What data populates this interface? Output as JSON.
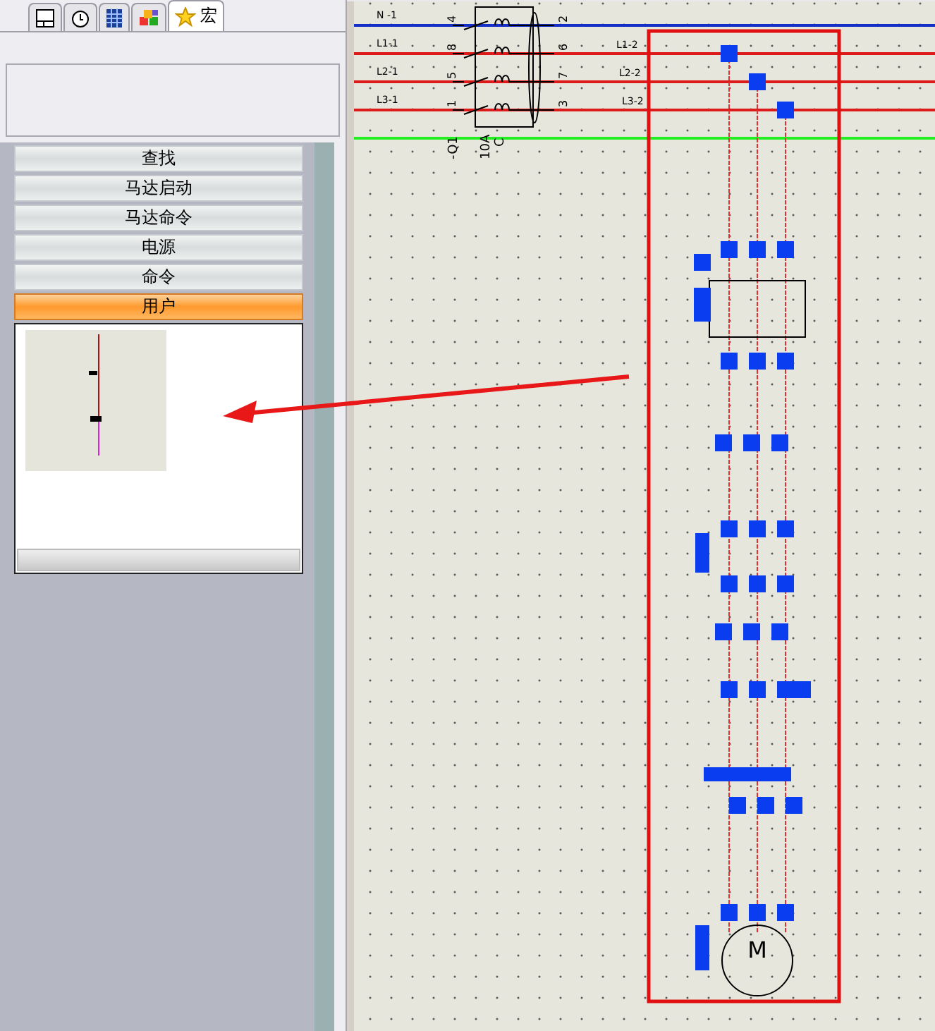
{
  "sidebar": {
    "tabs": [
      {
        "kind": "layout",
        "selected": false
      },
      {
        "kind": "clock",
        "selected": false
      },
      {
        "kind": "grid",
        "selected": false
      },
      {
        "kind": "cubes",
        "selected": false
      },
      {
        "kind": "star",
        "label": "宏",
        "selected": true
      }
    ],
    "groups": [
      {
        "label": "查找",
        "selected": false
      },
      {
        "label": "马达启动",
        "selected": false
      },
      {
        "label": "马达命令",
        "selected": false
      },
      {
        "label": "电源",
        "selected": false
      },
      {
        "label": "命令",
        "selected": false
      },
      {
        "label": "用户",
        "selected": true
      }
    ]
  },
  "schematic": {
    "bus_labels": [
      "N -1",
      "L1-1",
      "L2-1",
      "L3-1"
    ],
    "bus_labels_right": [
      "L1-2",
      "L2-2",
      "L3-2"
    ],
    "terminals_in": [
      "4",
      "8",
      "5",
      "1"
    ],
    "terminals_out": [
      "2",
      "6",
      "7",
      "3"
    ],
    "breaker_name": "-Q1",
    "breaker_rating": "10A",
    "breaker_curve": "C",
    "motor_label": "M"
  }
}
